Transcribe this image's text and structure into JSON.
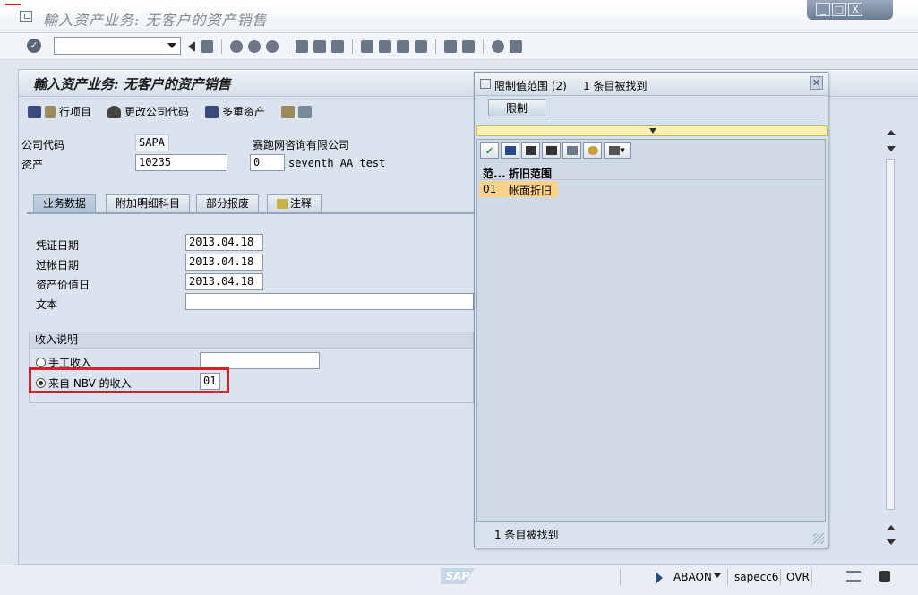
{
  "window": {
    "title": "輸入资产业务: 无客户的资产销售",
    "controls": [
      "_",
      "□",
      "X"
    ]
  },
  "main": {
    "title": "輸入资产业务: 无客户的资产销售",
    "appbar": {
      "line_items": "行项目",
      "change_company_code": "更改公司代码",
      "multiple_assets": "多重资产"
    },
    "company_code_label": "公司代码",
    "company_code_value": "SAPA",
    "company_name": "赛跑网咨询有限公司",
    "asset_label": "资产",
    "asset_value": "10235",
    "asset_sub": "0",
    "asset_desc": "seventh AA test",
    "tabs": [
      "业务数据",
      "附加明细科目",
      "部分报废",
      "注释"
    ],
    "doc_date_label": "凭证日期",
    "doc_date_value": "2013.04.18",
    "post_date_label": "过帐日期",
    "post_date_value": "2013.04.18",
    "value_date_label": "资产价值日",
    "value_date_value": "2013.04.18",
    "text_label": "文本",
    "text_value": "",
    "revenue_group_title": "收入说明",
    "manual_revenue_label": "手工收入",
    "manual_revenue_value": "",
    "nbv_revenue_label": "来自 NBV 的收入",
    "nbv_revenue_value": "01"
  },
  "popup": {
    "title": "限制值范围 (2)",
    "count_text": "1 条目被找到",
    "tab_label": "限制",
    "col1_header": "范...",
    "col2_header": "折旧范围",
    "row_code": "01",
    "row_name": "帐面折旧",
    "status_text": "1 条目被找到"
  },
  "statusbar": {
    "user": "ABAON",
    "system": "sapecc6",
    "mode": "OVR",
    "logo": "SAP"
  }
}
